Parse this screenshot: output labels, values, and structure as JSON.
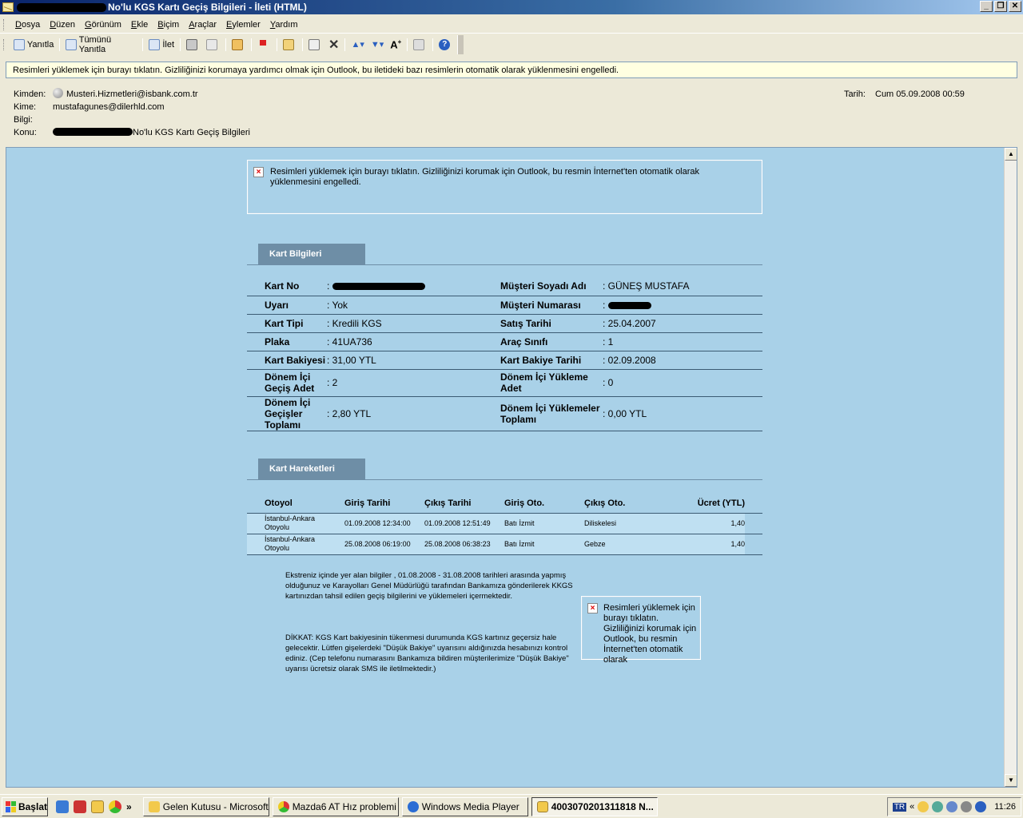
{
  "window": {
    "title": "No'lu KGS Kartı Geçiş Bilgileri - İleti (HTML)",
    "buttons": [
      "_",
      "❐",
      "✕"
    ]
  },
  "menu": [
    "Dosya",
    "Düzen",
    "Görünüm",
    "Ekle",
    "Biçim",
    "Araçlar",
    "Eylemler",
    "Yardım"
  ],
  "toolbar": {
    "reply": "Yanıtla",
    "reply_all": "Tümünü Yanıtla",
    "forward": "İlet"
  },
  "infobar": "Resimleri yüklemek için burayı tıklatın. Gizliliğinizi korumaya yardımcı olmak için Outlook, bu iletideki bazı resimlerin otomatik olarak yüklenmesini engelledi.",
  "header": {
    "from_label": "Kimden:",
    "from_value": "Musteri.Hizmetleri@isbank.com.tr",
    "to_label": "Kime:",
    "to_value": "mustafagunes@dilerhld.com",
    "cc_label": "Bilgi:",
    "cc_value": "",
    "subject_label": "Konu:",
    "subject_value": "No'lu KGS Kartı Geçiş Bilgileri",
    "date_label": "Tarih:",
    "date_value": "Cum 05.09.2008 00:59"
  },
  "blocked_image_top": "Resimleri yüklemek için burayı tıklatın. Gizliliğinizi korumak için Outlook, bu resmin İnternet'ten otomatik olarak yüklenmesini engelledi.",
  "blocked_image_side": "Resimleri yüklemek için burayı tıklatın. Gizliliğinizi korumak için Outlook, bu resmin İnternet'ten otomatik olarak",
  "kart_bilgileri": {
    "title": "Kart Bilgileri",
    "rows": [
      {
        "l1": "Kart No",
        "v1": ":",
        "l2": "Müşteri Soyadı Adı",
        "v2": ": GÜNEŞ MUSTAFA"
      },
      {
        "l1": "Uyarı",
        "v1": ": Yok",
        "l2": "Müşteri Numarası",
        "v2": ":"
      },
      {
        "l1": "Kart Tipi",
        "v1": ": Kredili KGS",
        "l2": "Satış Tarihi",
        "v2": ": 25.04.2007"
      },
      {
        "l1": "Plaka",
        "v1": ": 41UA736",
        "l2": "Araç Sınıfı",
        "v2": ": 1"
      },
      {
        "l1": "Kart Bakiyesi",
        "v1": ": 31,00 YTL",
        "l2": "Kart Bakiye Tarihi",
        "v2": ": 02.09.2008"
      },
      {
        "l1": "Dönem İçi Geçiş Adet",
        "v1": ": 2",
        "l2": "Dönem İçi Yükleme Adet",
        "v2": ": 0"
      },
      {
        "l1": "Dönem İçi Geçişler Toplamı",
        "v1": ": 2,80 YTL",
        "l2": "Dönem İçi Yüklemeler Toplamı",
        "v2": ": 0,00 YTL"
      }
    ]
  },
  "kart_hareketleri": {
    "title": "Kart Hareketleri",
    "columns": [
      "Otoyol",
      "Giriş Tarihi",
      "Çıkış Tarihi",
      "Giriş Oto.",
      "Çıkış Oto.",
      "Ücret (YTL)"
    ],
    "rows": [
      [
        "İstanbul-Ankara Otoyolu",
        "01.09.2008 12:34:00",
        "01.09.2008 12:51:49",
        "Batı İzmit",
        "Diliskelesi",
        "1,40"
      ],
      [
        "İstanbul-Ankara Otoyolu",
        "25.08.2008 06:19:00",
        "25.08.2008 06:38:23",
        "Batı İzmit",
        "Gebze",
        "1,40"
      ]
    ]
  },
  "note1": "Ekstreniz içinde yer alan bilgiler , 01.08.2008 - 31.08.2008 tarihleri arasında yapmış olduğunuz ve Karayolları Genel Müdürlüğü tarafından Bankamıza gönderilerek KKGS kartınızdan tahsil edilen geçiş bilgilerini ve yüklemeleri içermektedir.",
  "note2": "DİKKAT: KGS Kart bakiyesinin tükenmesi durumunda KGS kartınız geçersiz hale gelecektir. Lütfen gişelerdeki \"Düşük Bakiye\" uyarısını aldığınızda hesabınızı kontrol ediniz. (Cep telefonu numarasını Bankamıza bildiren müşterilerimize \"Düşük Bakiye\" uyarısı ücretsiz olarak SMS ile iletilmektedir.)",
  "taskbar": {
    "start": "Başlat",
    "chevron": "»",
    "tasks": [
      {
        "label": "Gelen Kutusu - Microsoft ...",
        "color": "#f2c94c"
      },
      {
        "label": "Mazda6 AT Hız problemi [...",
        "color": "#d33"
      },
      {
        "label": "Windows Media Player",
        "color": "#2a6cd4"
      },
      {
        "label": "4003070201311818 N...",
        "color": "#f2c94c"
      }
    ],
    "lang": "TR",
    "tray_chevron": "«",
    "clock": "11:26"
  }
}
